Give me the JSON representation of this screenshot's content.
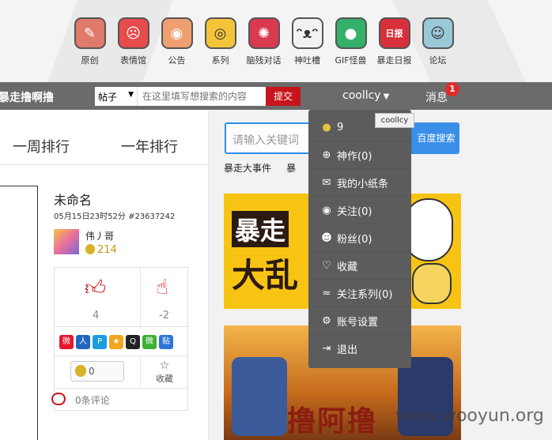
{
  "top_nav": {
    "items": [
      {
        "label": "原创",
        "icon": "pen-icon",
        "color": "#e07a6a"
      },
      {
        "label": "表情馆",
        "icon": "rage-face-icon",
        "color": "#e84b4b"
      },
      {
        "label": "公告",
        "icon": "notice-icon",
        "color": "#f0a070"
      },
      {
        "label": "系列",
        "icon": "eye-monster-icon",
        "color": "#f3c33a"
      },
      {
        "label": "脑残对话",
        "icon": "brain-vs-icon",
        "color": "#d93a50"
      },
      {
        "label": "神吐槽",
        "icon": "cat-face-icon",
        "color": "#f2f2f2"
      },
      {
        "label": "GIF怪兽",
        "icon": "green-monster-icon",
        "color": "#35b06a"
      },
      {
        "label": "暴走日报",
        "icon": "daily-report-icon",
        "color": "#d8303a"
      },
      {
        "label": "论坛",
        "icon": "forum-icon",
        "color": "#9ac9d8"
      }
    ]
  },
  "header": {
    "site_name": "暴走撸啊撸",
    "search_type": "帖子",
    "search_placeholder": "在这里填写想搜索的内容",
    "search_submit": "提交",
    "username": "coollcy",
    "messages_label": "消息",
    "messages_count": "1"
  },
  "rank_tabs": [
    "一周排行",
    "一年排行"
  ],
  "post": {
    "title": "未命名",
    "meta": "05月15日23时52分 #23637242",
    "author_name": "伟丿哥",
    "author_score": "214",
    "up_count": "4",
    "down_count": "-2",
    "coin_count": "0",
    "fav_label": "收藏",
    "comments": "0条评论",
    "share_icons": [
      "weibo-icon",
      "renren-icon",
      "qzone-icon",
      "qq-star-icon",
      "qq-penguin-icon",
      "wechat-icon",
      "tieba-icon"
    ]
  },
  "right": {
    "keyword_placeholder": "请输入关键词",
    "baidu_button": "百度搜索",
    "links": "暴走大事件     暴                        作器"
  },
  "dropdown": {
    "tooltip": "coollcy",
    "items": [
      {
        "label": "9",
        "icon": "coin-icon"
      },
      {
        "label": "神作(0)",
        "icon": "masterpiece-icon"
      },
      {
        "label": "我的小纸条",
        "icon": "envelope-icon"
      },
      {
        "label": "关注(0)",
        "icon": "eye-icon"
      },
      {
        "label": "粉丝(0)",
        "icon": "fans-icon"
      },
      {
        "label": "收藏",
        "icon": "heart-icon"
      },
      {
        "label": "关注系列(0)",
        "icon": "rss-icon"
      },
      {
        "label": "账号设置",
        "icon": "gear-icon"
      },
      {
        "label": "退出",
        "icon": "logout-icon"
      }
    ]
  },
  "banners": {
    "banner1_line1": "暴走",
    "banner1_line2": "大乱",
    "banner2_text": "撸阿撸"
  },
  "watermark": "www.wooyun.org"
}
